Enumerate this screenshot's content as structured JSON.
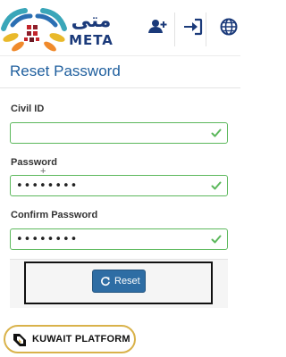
{
  "header": {
    "logo_arabic": "متى",
    "logo_latin": "META",
    "icons": [
      {
        "name": "add-user-icon"
      },
      {
        "name": "sign-in-icon"
      },
      {
        "name": "globe-icon"
      }
    ]
  },
  "page": {
    "title": "Reset Password"
  },
  "form": {
    "civil_id": {
      "label": "Civil ID",
      "value": ""
    },
    "password": {
      "label": "Password",
      "value": "••••••••"
    },
    "confirm_password": {
      "label": "Confirm Password",
      "value": "••••••••"
    }
  },
  "actions": {
    "reset_label": "Reset"
  },
  "watermark": {
    "text": "KUWAIT PLATFORM"
  },
  "colors": {
    "brand_blue": "#1b3a7a",
    "title_blue": "#1f5f9e",
    "button_blue": "#2e6da4",
    "valid_green": "#5cb85c",
    "badge_gold": "#d9b24a"
  }
}
